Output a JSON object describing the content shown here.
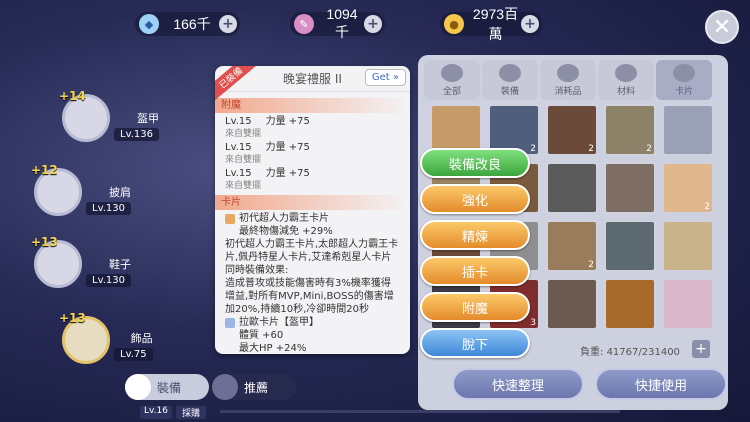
{
  "currency": [
    {
      "icon": "diamond-icon",
      "value": "166千"
    },
    {
      "icon": "feather-icon",
      "value": "1094千"
    },
    {
      "icon": "coin-icon",
      "value": "2973百萬"
    }
  ],
  "slots": [
    {
      "plus": "+14",
      "name": "盔甲",
      "lv": "Lv.136"
    },
    {
      "plus": "+12",
      "name": "披肩",
      "lv": "Lv.130"
    },
    {
      "plus": "+13",
      "name": "鞋子",
      "lv": "Lv.130"
    },
    {
      "plus": "+13",
      "name": "飾品",
      "lv": "Lv.75"
    }
  ],
  "card": {
    "title": "晚宴禮服 II",
    "ribbon": "已裝備",
    "get": "Get »",
    "enchant_header": "附魔",
    "enchants": [
      {
        "lv": "Lv.15",
        "stat": "力量 +75",
        "src": "來自雙擺"
      },
      {
        "lv": "Lv.15",
        "stat": "力量 +75",
        "src": "來自雙擺"
      },
      {
        "lv": "Lv.15",
        "stat": "力量 +75",
        "src": "來自雙擺"
      }
    ],
    "card_header": "卡片",
    "card1_name": "初代超人力霸王卡片",
    "card1_line1": "最終物傷減免 +29%",
    "card1_desc": "初代超人力霸王卡片,太郎超人力霸王卡片,佩丹特星人卡片,艾達希剋星人卡片同時裝備效果:",
    "card1_effect": "造成普攻或技能傷害時有3%機率獲得增益,對所有MVP,Mini,BOSS的傷害增加20%,持續10秒,冷卻時間20秒",
    "card2_name": "拉歐卡片【盔甲】",
    "card2_line1": "體質 +60",
    "card2_line2": "最大HP +24%"
  },
  "tabs": [
    "全部",
    "裝備",
    "消耗品",
    "材料",
    "卡片"
  ],
  "grid_counts": [
    "",
    "2",
    "2",
    "2",
    "",
    "",
    "",
    "",
    "",
    "2",
    "",
    "",
    "2",
    "",
    "",
    "",
    "3",
    "",
    "",
    "",
    "",
    "",
    "",
    "",
    ""
  ],
  "actions": [
    {
      "label": "裝備改良",
      "color": "green"
    },
    {
      "label": "強化",
      "color": "orange"
    },
    {
      "label": "精煉",
      "color": "orange"
    },
    {
      "label": "插卡",
      "color": "orange"
    },
    {
      "label": "附魔",
      "color": "orange"
    },
    {
      "label": "脫下",
      "color": "blue"
    }
  ],
  "weight_label": "負重:",
  "weight_value": "41767/231400",
  "bottom": {
    "sort": "快速整理",
    "use": "快捷使用"
  },
  "left_tabs": {
    "equip": "裝備",
    "recommend": "推薦"
  },
  "player": {
    "lv": "Lv.16",
    "name": "採購"
  }
}
